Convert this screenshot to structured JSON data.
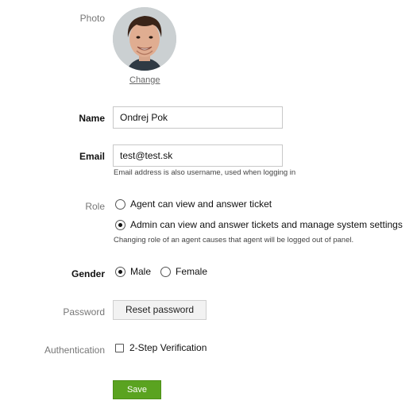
{
  "photo": {
    "label": "Photo",
    "change_label": "Change"
  },
  "name": {
    "label": "Name",
    "value": "Ondrej Pok"
  },
  "email": {
    "label": "Email",
    "value": "test@test.sk",
    "hint": "Email address is also username, used when logging in"
  },
  "role": {
    "label": "Role",
    "options": [
      {
        "label": "Agent can view and answer ticket",
        "checked": false
      },
      {
        "label": "Admin can view and answer tickets and manage system settings",
        "checked": true
      }
    ],
    "hint": "Changing role of an agent causes that agent will be logged out of panel."
  },
  "gender": {
    "label": "Gender",
    "options": [
      {
        "label": "Male",
        "checked": true
      },
      {
        "label": "Female",
        "checked": false
      }
    ]
  },
  "password": {
    "label": "Password",
    "reset_label": "Reset password"
  },
  "authentication": {
    "label": "Authentication",
    "two_step_label": "2-Step Verification",
    "checked": false
  },
  "save_label": "Save"
}
